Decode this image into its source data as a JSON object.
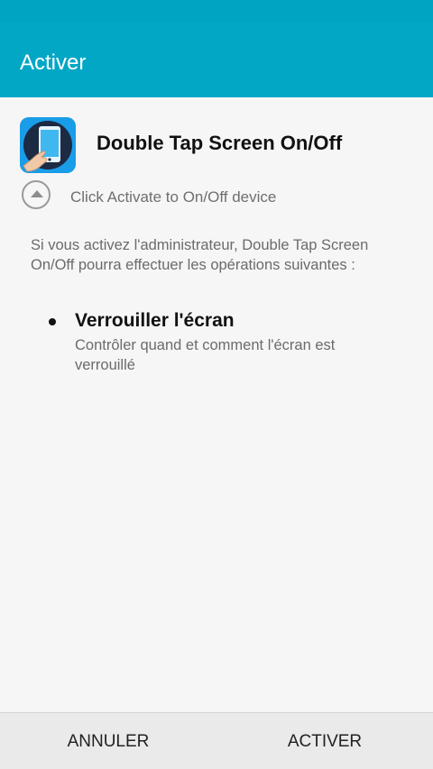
{
  "app_bar": {
    "title": "Activer"
  },
  "app": {
    "name": "Double Tap Screen On/Off",
    "icon": "double-tap-phone-app-icon"
  },
  "expand": {
    "icon": "chevron-up-circle-icon",
    "text": "Click Activate to On/Off device"
  },
  "description": "Si vous activez l'administrateur, Double Tap Screen On/Off pourra effectuer les opérations suivantes :",
  "policies": [
    {
      "title": "Verrouiller l'écran",
      "description": "Contrôler quand et comment l'écran est verrouillé"
    }
  ],
  "buttons": {
    "cancel": "ANNULER",
    "activate": "ACTIVER"
  },
  "colors": {
    "accent": "#03a7c6",
    "status_bar": "#00a4c3",
    "background": "#f6f6f6",
    "bottom_bar": "#eaeaea"
  }
}
